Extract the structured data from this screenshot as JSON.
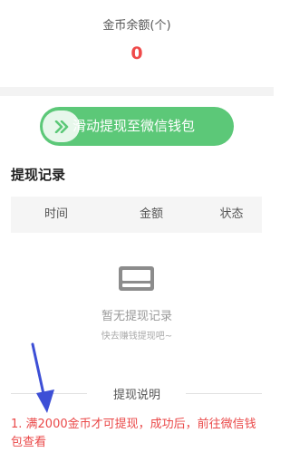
{
  "balance": {
    "label": "金币余额(个)",
    "value": "0"
  },
  "withdraw_slider": {
    "label": "滑动提现至微信钱包",
    "handle_icon": "double-chevron-right-icon",
    "color": "#5cc878"
  },
  "records": {
    "title": "提现记录",
    "columns": [
      "时间",
      "金额",
      "状态"
    ],
    "empty_title": "暂无提现记录",
    "empty_subtitle": "快去赚钱提现吧~",
    "empty_icon": "empty-box-icon"
  },
  "description": {
    "title": "提现说明",
    "rule_1": "1. 满2000金币才可提现，成功后，前往微信钱包查看"
  },
  "annotation": {
    "arrow_color": "#3d4fd6"
  }
}
